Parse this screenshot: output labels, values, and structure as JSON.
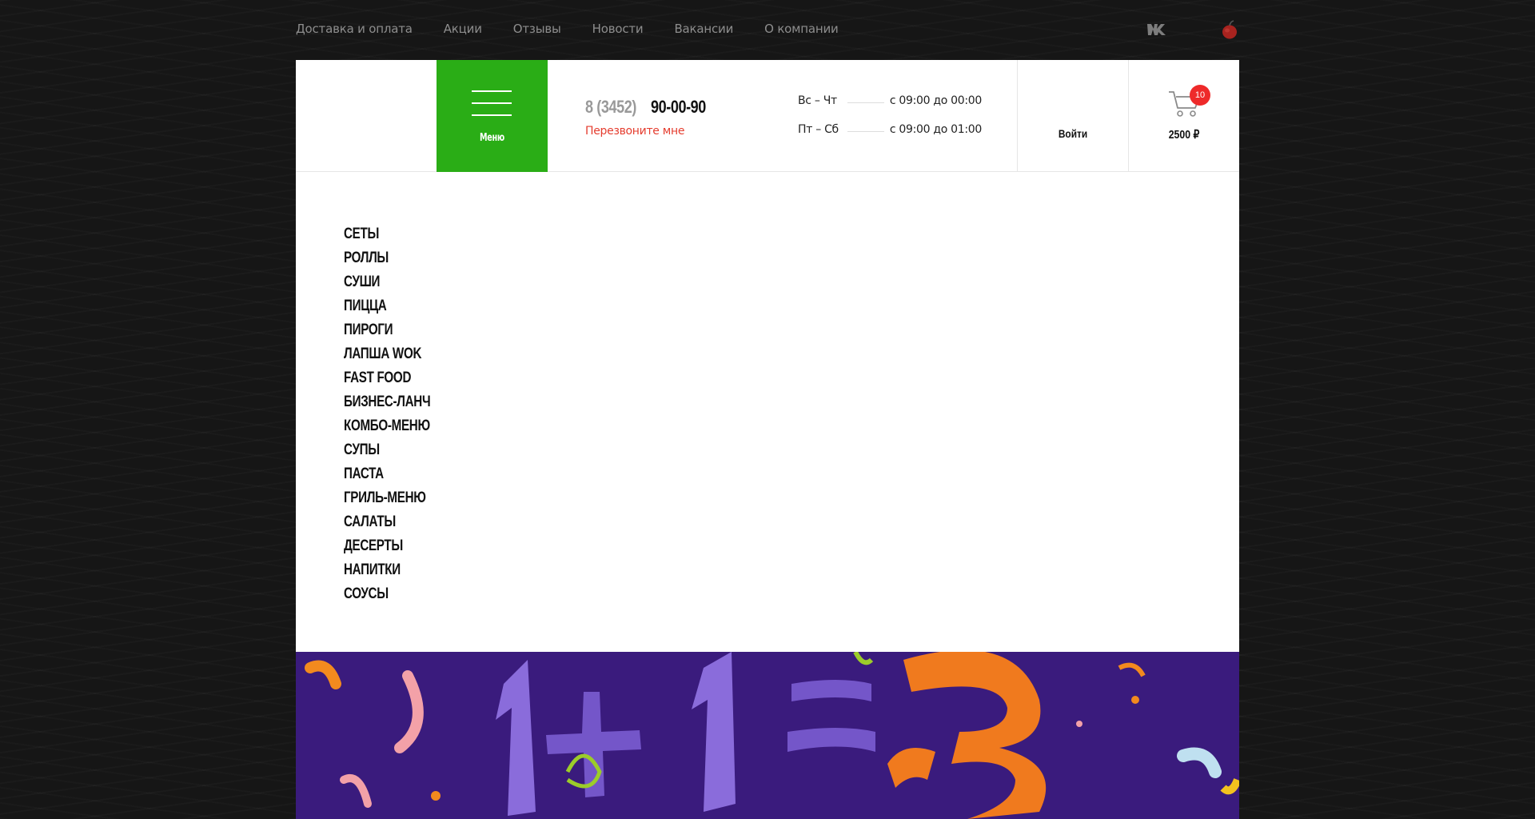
{
  "topnav": {
    "links": [
      "Доставка и оплата",
      "Акции",
      "Отзывы",
      "Новости",
      "Вакансии",
      "О компании"
    ]
  },
  "header": {
    "menu_label": "Меню",
    "phone_code": "8 (3452)",
    "phone_number": "90-00-90",
    "callback_label": "Перезвоните мне",
    "hours": [
      {
        "days": "Вс – Чт",
        "time": "с 09:00 до 00:00"
      },
      {
        "days": "Пт – Сб",
        "time": "с 09:00 до 01:00"
      }
    ],
    "login_label": "Войти",
    "cart_count": "10",
    "cart_total": "2500 ₽"
  },
  "menu": {
    "items": [
      "Сеты",
      "Роллы",
      "Суши",
      "Пицца",
      "Пироги",
      "Лапша WOK",
      "Fast Food",
      "Бизнес-ланч",
      "Комбо-меню",
      "Супы",
      "Паста",
      "Гриль-меню",
      "Салаты",
      "Десерты",
      "Напитки",
      "Соусы"
    ]
  },
  "colors": {
    "accent_green": "#2aad16",
    "callback_red": "#e53d2f",
    "badge_red": "#ee2a2a",
    "banner_purple": "#3a1b7d"
  },
  "icons": {
    "social": "vk-icon",
    "app": "apple-icon",
    "cart": "cart-icon",
    "menu": "hamburger-icon"
  }
}
